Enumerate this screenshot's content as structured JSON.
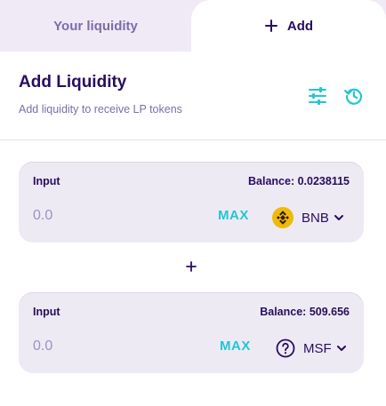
{
  "tabs": {
    "your_liquidity": "Your liquidity",
    "add": "Add"
  },
  "header": {
    "title": "Add Liquidity",
    "subtitle": "Add liquidity to receive LP tokens"
  },
  "input_a": {
    "label": "Input",
    "balance": "Balance: 0.0238115",
    "placeholder": "0.0",
    "max_label": "MAX",
    "token": "BNB",
    "token_icon": "bnb-icon"
  },
  "input_b": {
    "label": "Input",
    "balance": "Balance: 509.656",
    "placeholder": "0.0",
    "max_label": "MAX",
    "token": "MSF",
    "token_icon": "question-circle-icon"
  },
  "colors": {
    "primary_text": "#280d5f",
    "secondary_text": "#7a6eaa",
    "accent": "#1fc7d4",
    "panel_bg": "#eeeaf4",
    "bnb_yellow": "#f0b90b"
  }
}
